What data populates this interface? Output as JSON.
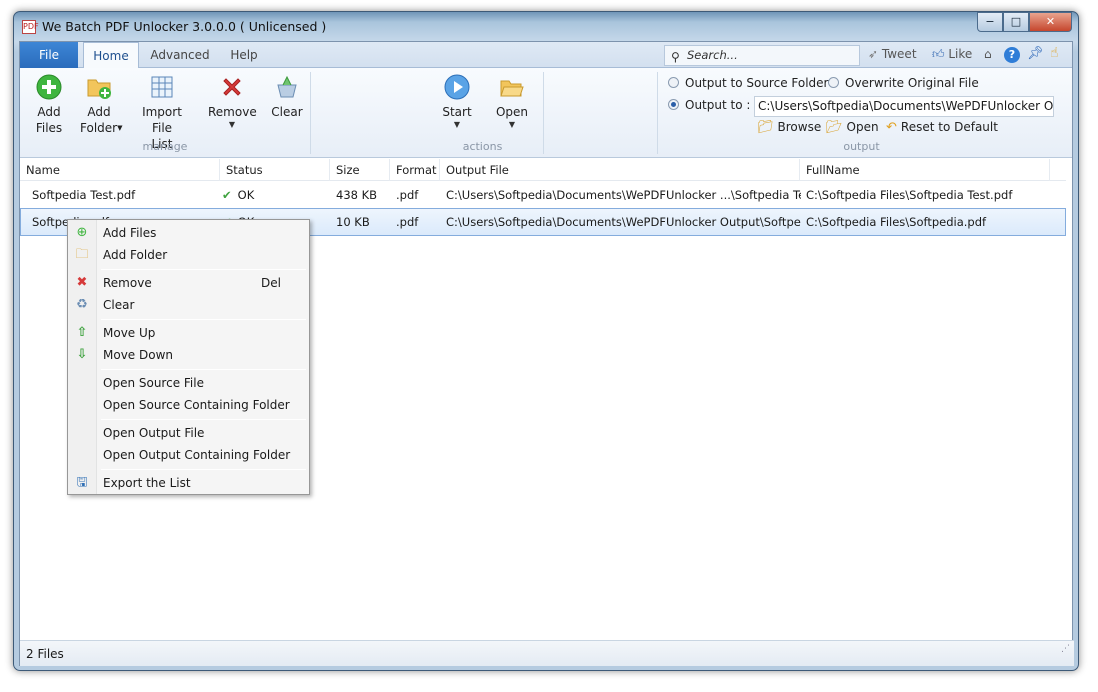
{
  "window": {
    "title": "We Batch PDF Unlocker 3.0.0.0  ( Unlicensed )",
    "controls": [
      "−",
      "□",
      "✕"
    ]
  },
  "tabs": {
    "file": "File",
    "home": "Home",
    "advanced": "Advanced",
    "help": "Help"
  },
  "search": {
    "placeholder": "Search..."
  },
  "social": {
    "tweet": "Tweet",
    "like": "Like"
  },
  "ribbon": {
    "add_files": [
      "Add",
      "Files"
    ],
    "add_folder": [
      "Add",
      "Folder"
    ],
    "import_file_list": [
      "Import File",
      "List"
    ],
    "remove": "Remove",
    "clear": "Clear",
    "group_manage": "manage",
    "start": "Start",
    "open": "Open",
    "group_actions": "actions",
    "output_to_source": "Output to Source Folder",
    "overwrite_original": "Overwrite Original File",
    "output_to": "Output to :",
    "output_path": "C:\\Users\\Softpedia\\Documents\\WePDFUnlocker Output",
    "browse": "Browse",
    "open_small": "Open",
    "reset_default": "Reset to Default",
    "group_output": "output"
  },
  "columns": [
    "Name",
    "Status",
    "Size",
    "Format",
    "Output File",
    "FullName"
  ],
  "rows": [
    {
      "name": "Softpedia Test.pdf",
      "status": "OK",
      "size": "438 KB",
      "format": ".pdf",
      "output": "C:\\Users\\Softpedia\\Documents\\WePDFUnlocker ...\\Softpedia Test.pdf",
      "fullname": "C:\\Softpedia Files\\Softpedia Test.pdf"
    },
    {
      "name": "Softpedia.pdf",
      "status": "OK",
      "size": "10 KB",
      "format": ".pdf",
      "output": "C:\\Users\\Softpedia\\Documents\\WePDFUnlocker Output\\Softpedia.pdf",
      "fullname": "C:\\Softpedia Files\\Softpedia.pdf"
    }
  ],
  "context_menu": {
    "add_files": "Add Files",
    "add_folder": "Add Folder",
    "remove": "Remove",
    "remove_key": "Del",
    "clear": "Clear",
    "move_up": "Move Up",
    "move_down": "Move Down",
    "open_source_file": "Open Source File",
    "open_source_folder": "Open Source Containing Folder",
    "open_output_file": "Open Output File",
    "open_output_folder": "Open Output Containing Folder",
    "export_list": "Export the List"
  },
  "status": {
    "count": "2 Files"
  },
  "colors": {
    "accent": "#2a6cbc",
    "selection": "#dbeafb",
    "ok": "#3fa23f",
    "remove": "#d63a3a"
  }
}
